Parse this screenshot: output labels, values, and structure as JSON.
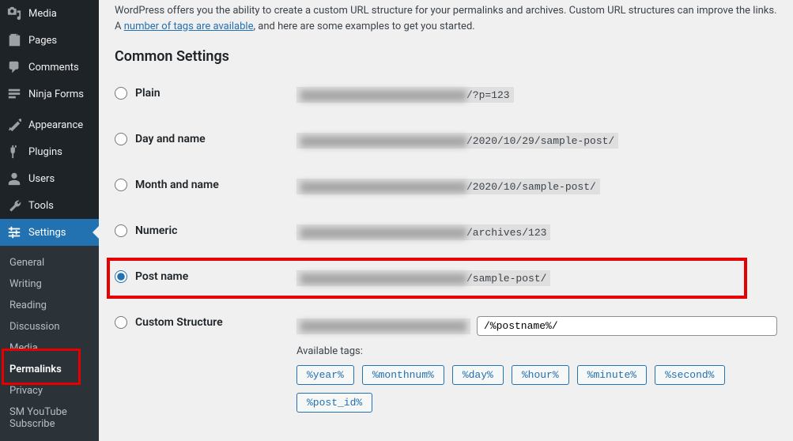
{
  "sidebar": {
    "top_items": [
      {
        "label": "Media",
        "icon": "media"
      },
      {
        "label": "Pages",
        "icon": "pages"
      },
      {
        "label": "Comments",
        "icon": "comments"
      },
      {
        "label": "Ninja Forms",
        "icon": "forms"
      }
    ],
    "bottom_items": [
      {
        "label": "Appearance",
        "icon": "appearance"
      },
      {
        "label": "Plugins",
        "icon": "plugins"
      },
      {
        "label": "Users",
        "icon": "users"
      },
      {
        "label": "Tools",
        "icon": "tools"
      },
      {
        "label": "Settings",
        "icon": "settings",
        "current": true
      }
    ],
    "submenu": [
      {
        "label": "General"
      },
      {
        "label": "Writing"
      },
      {
        "label": "Reading"
      },
      {
        "label": "Discussion"
      },
      {
        "label": "Media"
      },
      {
        "label": "Permalinks",
        "current": true
      },
      {
        "label": "Privacy"
      },
      {
        "label": "SM YouTube Subscribe"
      }
    ]
  },
  "intro": {
    "text1": "WordPress offers you the ability to create a custom URL structure for your permalinks and archives. Custom URL structures can improve the  links. A ",
    "link": "number of tags are available",
    "text2": ", and here are some examples to get you started."
  },
  "section_title": "Common Settings",
  "options": [
    {
      "name": "plain",
      "label": "Plain",
      "suffix": "/?p=123"
    },
    {
      "name": "day-name",
      "label": "Day and name",
      "suffix": "/2020/10/29/sample-post/"
    },
    {
      "name": "month-name",
      "label": "Month and name",
      "suffix": "/2020/10/sample-post/"
    },
    {
      "name": "numeric",
      "label": "Numeric",
      "suffix": "/archives/123"
    },
    {
      "name": "post-name",
      "label": "Post name",
      "suffix": "/sample-post/",
      "selected": true,
      "highlight": true
    },
    {
      "name": "custom",
      "label": "Custom Structure",
      "custom": true,
      "input_value": "/%postname%/"
    }
  ],
  "available_tags_label": "Available tags:",
  "tags": [
    "%year%",
    "%monthnum%",
    "%day%",
    "%hour%",
    "%minute%",
    "%second%",
    "%post_id%"
  ]
}
